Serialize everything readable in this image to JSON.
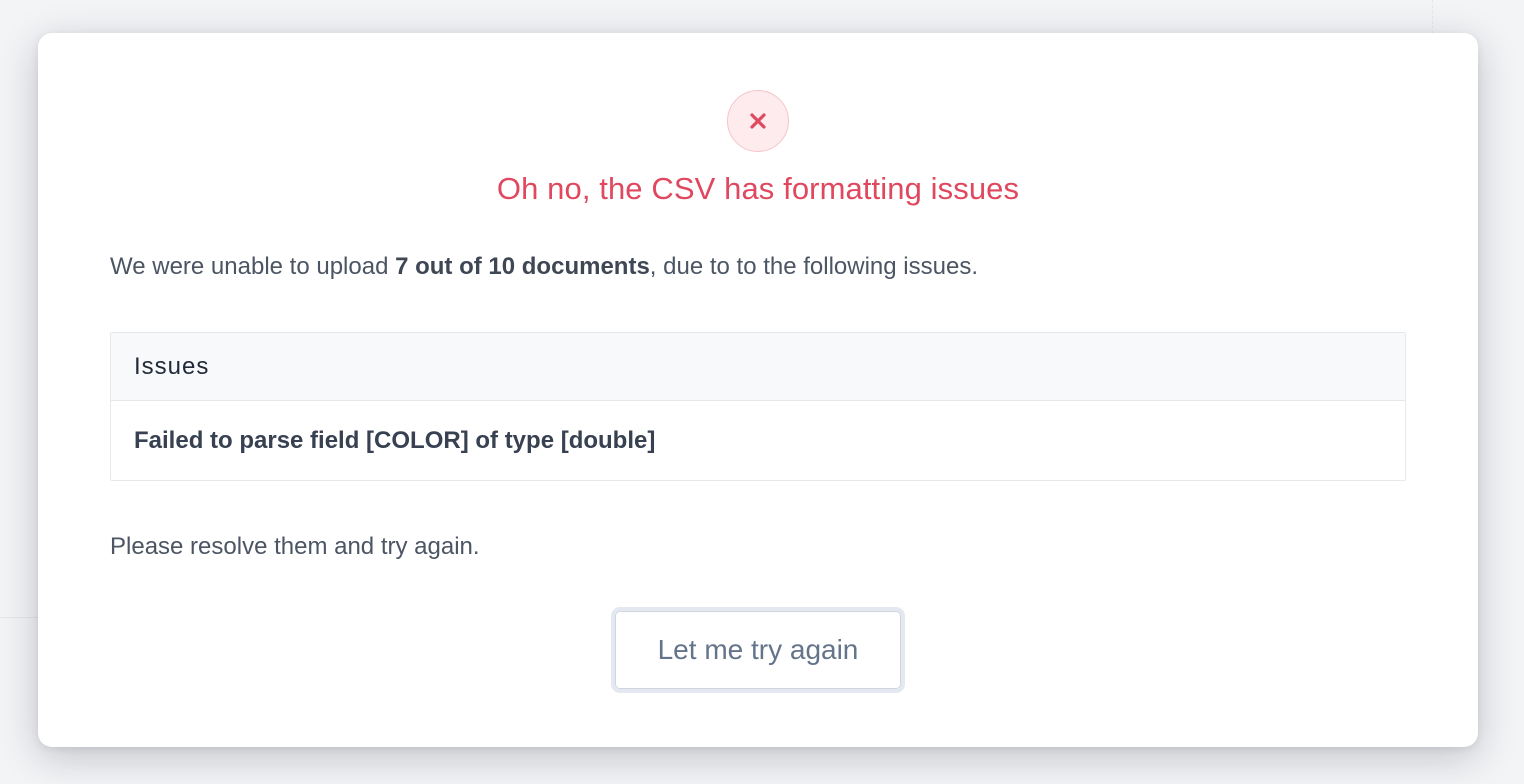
{
  "dialog": {
    "status_icon": "close-icon",
    "title": "Oh no, the CSV has formatting issues",
    "message": {
      "prefix": "We were unable to upload ",
      "emphasis": "7 out of 10 documents",
      "suffix": ", due to to the following issues."
    },
    "issues_table": {
      "header": "Issues",
      "rows": [
        "Failed to parse field [COLOR] of type [double]"
      ]
    },
    "footer_text": "Please resolve them and try again.",
    "retry_label": "Let me try again"
  },
  "colors": {
    "error": "#e0485f",
    "error_bg": "#fdebed",
    "text": "#4b5563",
    "button_text": "#64748b"
  }
}
